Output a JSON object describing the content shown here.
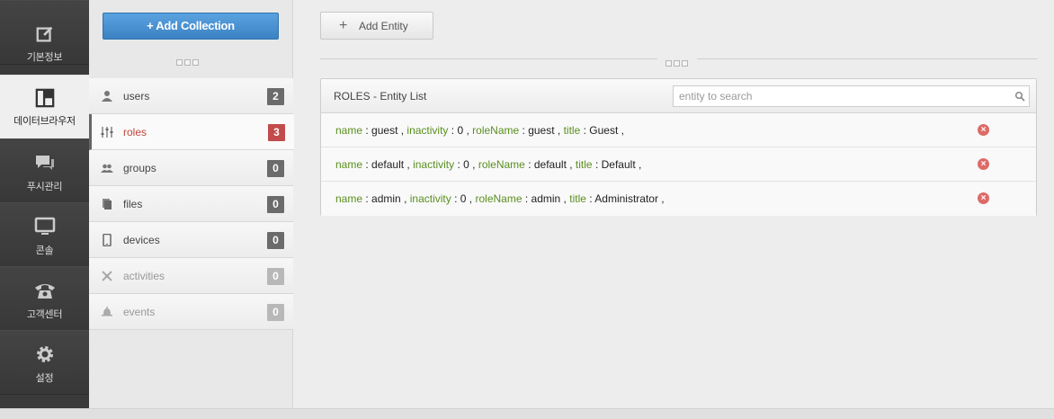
{
  "nav": {
    "items": [
      {
        "label": "기본정보",
        "icon": "edit-icon"
      },
      {
        "label": "데이터브라우저",
        "icon": "layout-icon",
        "active": true
      },
      {
        "label": "푸시관리",
        "icon": "chat-icon"
      },
      {
        "label": "콘솔",
        "icon": "monitor-icon"
      },
      {
        "label": "고객센터",
        "icon": "phone-icon"
      },
      {
        "label": "설정",
        "icon": "gear-icon"
      }
    ]
  },
  "collections": {
    "add_label": "+ Add Collection",
    "items": [
      {
        "name": "users",
        "count": "2",
        "icon": "user-icon"
      },
      {
        "name": "roles",
        "count": "3",
        "icon": "sliders-icon",
        "active": true
      },
      {
        "name": "groups",
        "count": "0",
        "icon": "group-icon"
      },
      {
        "name": "files",
        "count": "0",
        "icon": "files-icon"
      },
      {
        "name": "devices",
        "count": "0",
        "icon": "device-icon"
      },
      {
        "name": "activities",
        "count": "0",
        "icon": "activity-icon",
        "dim": true
      },
      {
        "name": "events",
        "count": "0",
        "icon": "bell-icon",
        "dim": true
      }
    ]
  },
  "main": {
    "add_entity_label": "Add Entity",
    "panel_title": "ROLES - Entity List",
    "search_placeholder": "entity to search",
    "rows": [
      {
        "name": "guest",
        "inactivity": "0",
        "roleName": "guest",
        "title": "Guest"
      },
      {
        "name": "default",
        "inactivity": "0",
        "roleName": "default",
        "title": "Default"
      },
      {
        "name": "admin",
        "inactivity": "0",
        "roleName": "admin",
        "title": "Administrator"
      }
    ],
    "keys": {
      "name": "name",
      "inactivity": "inactivity",
      "roleName": "roleName",
      "title": "title"
    }
  },
  "colors": {
    "accent_blue": "#3b82c4",
    "active_red": "#c24b4b",
    "key_green": "#5a8f1f"
  }
}
